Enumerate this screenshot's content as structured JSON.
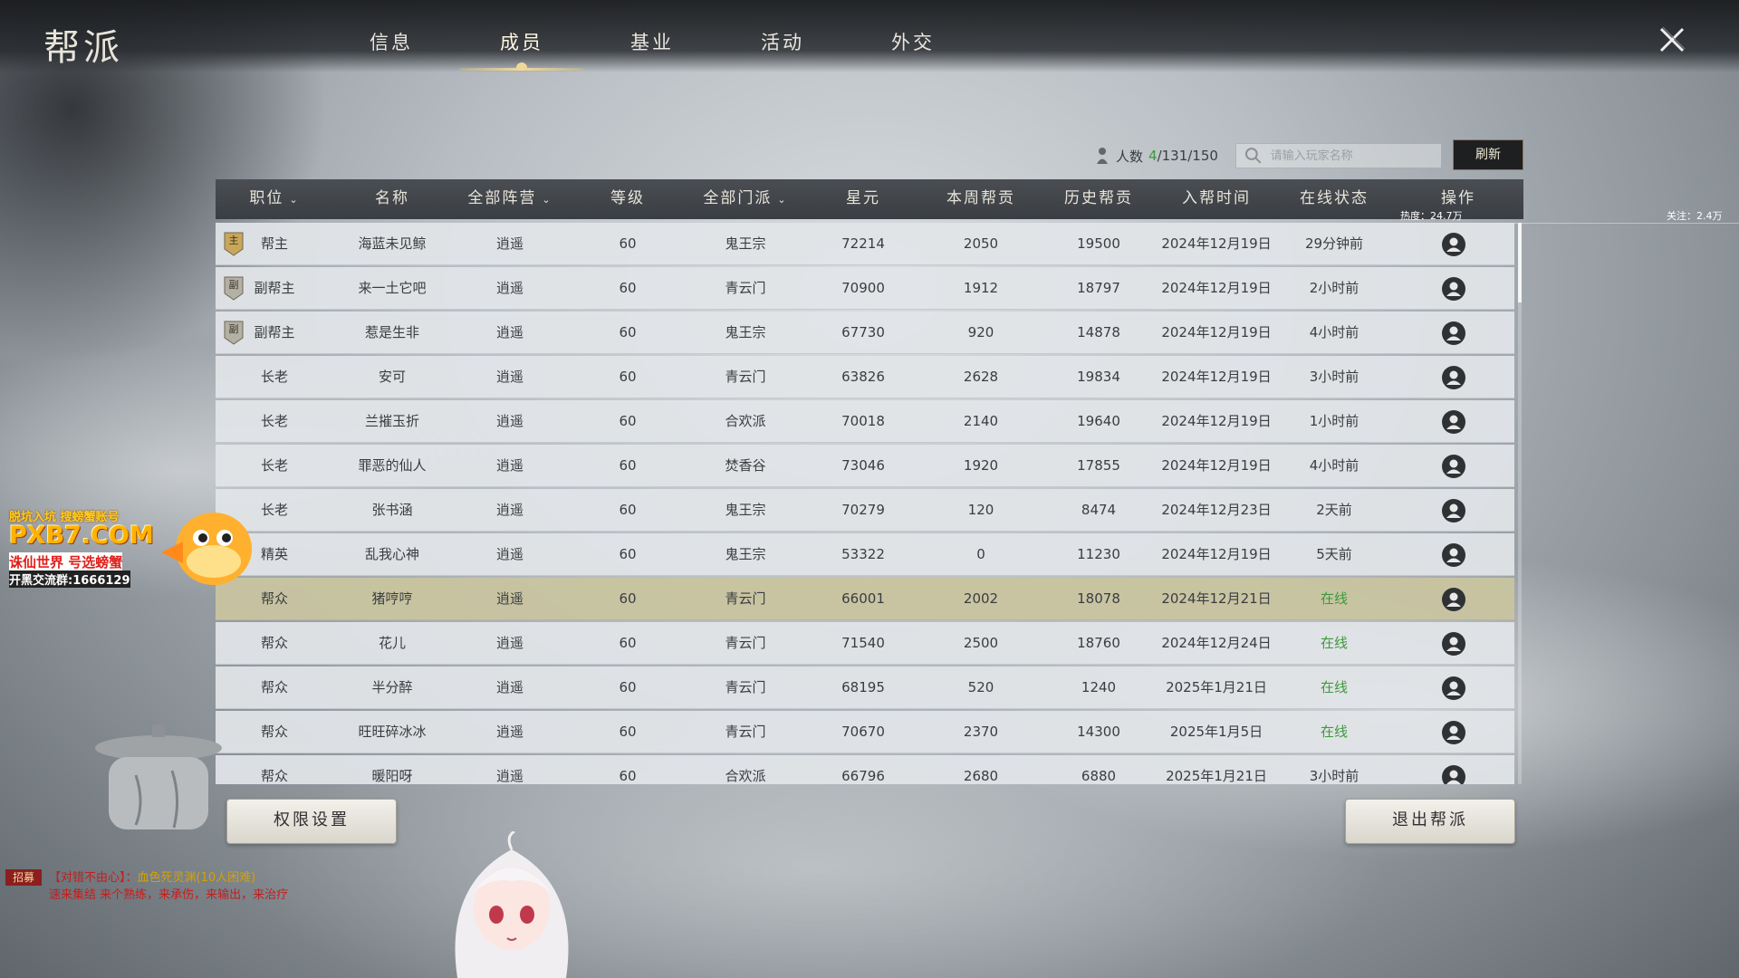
{
  "window": {
    "title": "帮派"
  },
  "tabs": [
    {
      "label": "信息",
      "active": false
    },
    {
      "label": "成员",
      "active": true
    },
    {
      "label": "基业",
      "active": false
    },
    {
      "label": "活动",
      "active": false
    },
    {
      "label": "外交",
      "active": false
    }
  ],
  "toolbar": {
    "count_label": "人数",
    "count_current": "4",
    "count_rest": "/131/150",
    "search_placeholder": "请输入玩家名称",
    "refresh_label": "刷新"
  },
  "stats": {
    "heat": "热度：24.7万",
    "follow": "关注：2.4万"
  },
  "table": {
    "headers": [
      "职位",
      "名称",
      "全部阵营",
      "等级",
      "全部门派",
      "星元",
      "本周帮贡",
      "历史帮贡",
      "入帮时间",
      "在线状态",
      "操作"
    ],
    "rows": [
      {
        "rank": "帮主",
        "badge": "主",
        "name": "海蓝未见鲸",
        "camp": "逍遥",
        "level": "60",
        "sect": "鬼王宗",
        "star": "72214",
        "week": "2050",
        "total": "19500",
        "joined": "2024年12月19日",
        "status": "29分钟前",
        "online": false,
        "self": false
      },
      {
        "rank": "副帮主",
        "badge": "副",
        "name": "来一土它吧",
        "camp": "逍遥",
        "level": "60",
        "sect": "青云门",
        "star": "70900",
        "week": "1912",
        "total": "18797",
        "joined": "2024年12月19日",
        "status": "2小时前",
        "online": false,
        "self": false
      },
      {
        "rank": "副帮主",
        "badge": "副",
        "name": "惹是生非",
        "camp": "逍遥",
        "level": "60",
        "sect": "鬼王宗",
        "star": "67730",
        "week": "920",
        "total": "14878",
        "joined": "2024年12月19日",
        "status": "4小时前",
        "online": false,
        "self": false
      },
      {
        "rank": "长老",
        "badge": "",
        "name": "安可",
        "camp": "逍遥",
        "level": "60",
        "sect": "青云门",
        "star": "63826",
        "week": "2628",
        "total": "19834",
        "joined": "2024年12月19日",
        "status": "3小时前",
        "online": false,
        "self": false
      },
      {
        "rank": "长老",
        "badge": "",
        "name": "兰摧玉折",
        "camp": "逍遥",
        "level": "60",
        "sect": "合欢派",
        "star": "70018",
        "week": "2140",
        "total": "19640",
        "joined": "2024年12月19日",
        "status": "1小时前",
        "online": false,
        "self": false
      },
      {
        "rank": "长老",
        "badge": "",
        "name": "罪恶的仙人",
        "camp": "逍遥",
        "level": "60",
        "sect": "焚香谷",
        "star": "73046",
        "week": "1920",
        "total": "17855",
        "joined": "2024年12月19日",
        "status": "4小时前",
        "online": false,
        "self": false
      },
      {
        "rank": "长老",
        "badge": "",
        "name": "张书涵",
        "camp": "逍遥",
        "level": "60",
        "sect": "鬼王宗",
        "star": "70279",
        "week": "120",
        "total": "8474",
        "joined": "2024年12月23日",
        "status": "2天前",
        "online": false,
        "self": false
      },
      {
        "rank": "精英",
        "badge": "",
        "name": "乱我心神",
        "camp": "逍遥",
        "level": "60",
        "sect": "鬼王宗",
        "star": "53322",
        "week": "0",
        "total": "11230",
        "joined": "2024年12月19日",
        "status": "5天前",
        "online": false,
        "self": false
      },
      {
        "rank": "帮众",
        "badge": "",
        "name": "猪哼哼",
        "camp": "逍遥",
        "level": "60",
        "sect": "青云门",
        "star": "66001",
        "week": "2002",
        "total": "18078",
        "joined": "2024年12月21日",
        "status": "在线",
        "online": true,
        "self": true
      },
      {
        "rank": "帮众",
        "badge": "",
        "name": "花儿",
        "camp": "逍遥",
        "level": "60",
        "sect": "青云门",
        "star": "71540",
        "week": "2500",
        "total": "18760",
        "joined": "2024年12月24日",
        "status": "在线",
        "online": true,
        "self": false
      },
      {
        "rank": "帮众",
        "badge": "",
        "name": "半分醉",
        "camp": "逍遥",
        "level": "60",
        "sect": "青云门",
        "star": "68195",
        "week": "520",
        "total": "1240",
        "joined": "2025年1月21日",
        "status": "在线",
        "online": true,
        "self": false
      },
      {
        "rank": "帮众",
        "badge": "",
        "name": "旺旺碎冰冰",
        "camp": "逍遥",
        "level": "60",
        "sect": "青云门",
        "star": "70670",
        "week": "2370",
        "total": "14300",
        "joined": "2025年1月5日",
        "status": "在线",
        "online": true,
        "self": false
      },
      {
        "rank": "帮众",
        "badge": "",
        "name": "暖阳呀",
        "camp": "逍遥",
        "level": "60",
        "sect": "合欢派",
        "star": "66796",
        "week": "2680",
        "total": "6880",
        "joined": "2025年1月21日",
        "status": "3小时前",
        "online": false,
        "self": false
      }
    ]
  },
  "buttons": {
    "permissions": "权限设置",
    "exit": "退出帮派"
  },
  "promo": {
    "line1": "脱坑入坑 搜螃蟹账号",
    "line2": "PXB7.COM",
    "line3": "诛仙世界 号选螃蟹",
    "line4": "开黑交流群:1666129"
  },
  "chat": {
    "tag": "招募",
    "sender": "【对错不由心】：",
    "highlight": "血色死灵渊(10人困难)",
    "message": "速来集结 来个熟练，来承伤，来输出，来治疗"
  },
  "colors": {
    "online": "#3c9a3c",
    "accent_gold": "#f1d898",
    "header_bg": "#3a3d42"
  }
}
